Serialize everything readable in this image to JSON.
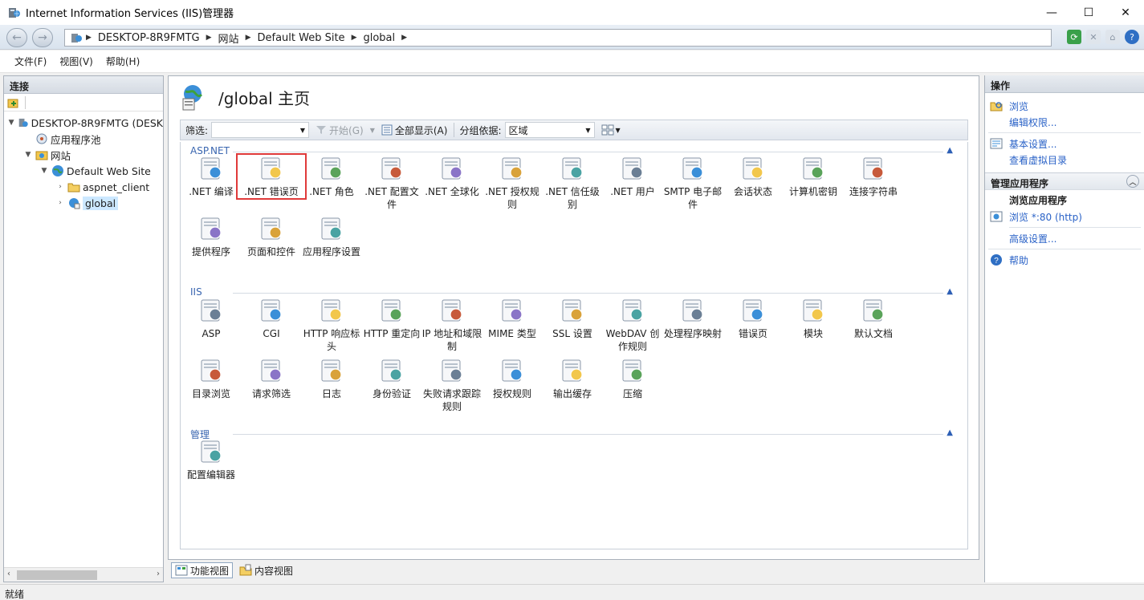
{
  "window": {
    "title": "Internet Information Services (IIS)管理器",
    "controls": {
      "minimize": "—",
      "maximize": "☐",
      "close": "✕"
    }
  },
  "address": {
    "back": "←",
    "forward": "→",
    "crumbs": [
      "DESKTOP-8R9FMTG",
      "网站",
      "Default Web Site",
      "global"
    ]
  },
  "menu": {
    "items": [
      "文件(F)",
      "视图(V)",
      "帮助(H)"
    ]
  },
  "connections": {
    "header": "连接",
    "tree": [
      {
        "label": "DESKTOP-8R9FMTG (DESK",
        "icon": "server-icon",
        "expander": "expanded"
      },
      {
        "label": "应用程序池",
        "icon": "app-pool-icon",
        "expander": ""
      },
      {
        "label": "网站",
        "icon": "sites-folder-icon",
        "expander": "expanded"
      },
      {
        "label": "Default Web Site",
        "icon": "globe-icon",
        "expander": "expanded"
      },
      {
        "label": "aspnet_client",
        "icon": "folder-icon",
        "expander": "collapsed"
      },
      {
        "label": "global",
        "icon": "web-app-icon",
        "expander": "collapsed"
      }
    ]
  },
  "main": {
    "title": "/global 主页",
    "filter": {
      "label": "筛选:",
      "start": "开始(G)",
      "show_all": "全部显示(A)",
      "group_label": "分组依据:",
      "group_value": "区域"
    },
    "groups": [
      {
        "title": "ASP.NET",
        "items": [
          {
            "label": ".NET 编译",
            "icon": "net-compile-icon"
          },
          {
            "label": ".NET 错误页",
            "icon": "net-error-pages-icon",
            "highlighted": true
          },
          {
            "label": ".NET 角色",
            "icon": "net-roles-icon"
          },
          {
            "label": ".NET 配置文件",
            "icon": "net-profile-icon"
          },
          {
            "label": ".NET 全球化",
            "icon": "net-globalization-icon"
          },
          {
            "label": ".NET 授权规则",
            "icon": "net-authorization-icon"
          },
          {
            "label": ".NET 信任级别",
            "icon": "net-trust-icon"
          },
          {
            "label": ".NET 用户",
            "icon": "net-users-icon"
          },
          {
            "label": "SMTP 电子邮件",
            "icon": "smtp-email-icon"
          },
          {
            "label": "会话状态",
            "icon": "session-state-icon"
          },
          {
            "label": "计算机密钥",
            "icon": "machine-key-icon"
          },
          {
            "label": "连接字符串",
            "icon": "connection-strings-icon"
          },
          {
            "label": "提供程序",
            "icon": "providers-icon"
          },
          {
            "label": "页面和控件",
            "icon": "pages-controls-icon"
          },
          {
            "label": "应用程序设置",
            "icon": "app-settings-icon"
          }
        ]
      },
      {
        "title": "IIS",
        "items": [
          {
            "label": "ASP",
            "icon": "asp-icon"
          },
          {
            "label": "CGI",
            "icon": "cgi-icon"
          },
          {
            "label": "HTTP 响应标头",
            "icon": "http-headers-icon"
          },
          {
            "label": "HTTP 重定向",
            "icon": "http-redirect-icon"
          },
          {
            "label": "IP 地址和域限制",
            "icon": "ip-restrictions-icon"
          },
          {
            "label": "MIME 类型",
            "icon": "mime-types-icon"
          },
          {
            "label": "SSL 设置",
            "icon": "ssl-lock-icon"
          },
          {
            "label": "WebDAV 创作规则",
            "icon": "webdav-icon"
          },
          {
            "label": "处理程序映射",
            "icon": "handler-mappings-icon"
          },
          {
            "label": "错误页",
            "icon": "error-pages-icon"
          },
          {
            "label": "模块",
            "icon": "modules-icon"
          },
          {
            "label": "默认文档",
            "icon": "default-document-icon"
          },
          {
            "label": "目录浏览",
            "icon": "directory-browsing-icon"
          },
          {
            "label": "请求筛选",
            "icon": "request-filtering-icon"
          },
          {
            "label": "日志",
            "icon": "logging-icon"
          },
          {
            "label": "身份验证",
            "icon": "authentication-icon"
          },
          {
            "label": "失败请求跟踪规则",
            "icon": "failed-request-tracing-icon"
          },
          {
            "label": "授权规则",
            "icon": "authorization-rules-icon"
          },
          {
            "label": "输出缓存",
            "icon": "output-caching-icon"
          },
          {
            "label": "压缩",
            "icon": "compression-icon"
          }
        ]
      },
      {
        "title": "管理",
        "items": [
          {
            "label": "配置编辑器",
            "icon": "configuration-editor-icon"
          }
        ]
      }
    ],
    "views": {
      "features": "功能视图",
      "content": "内容视图"
    }
  },
  "actions": {
    "header": "操作",
    "links": [
      {
        "label": "浏览",
        "icon": "explore-icon"
      },
      {
        "label": "编辑权限...",
        "icon": ""
      }
    ],
    "links2": [
      {
        "label": "基本设置...",
        "icon": "basic-settings-icon"
      },
      {
        "label": "查看虚拟目录",
        "icon": ""
      }
    ],
    "manage_section": "管理应用程序",
    "browse_subhead": "浏览应用程序",
    "browse_link": "浏览 *:80 (http)",
    "advanced": "高级设置...",
    "help": "帮助"
  },
  "status": {
    "text": "就绪"
  },
  "colors": {
    "accent": "#2a62c7",
    "highlight_border": "#e03a3a",
    "selected": "#cce8ff"
  }
}
